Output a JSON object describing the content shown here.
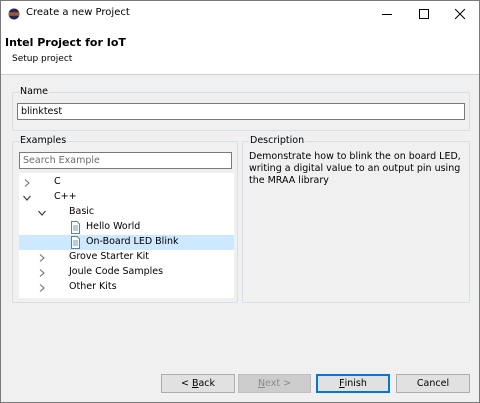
{
  "window": {
    "title": "Create a new Project",
    "controls": {
      "minimize": "minimize-icon",
      "maximize": "maximize-icon",
      "close": "close-icon"
    }
  },
  "header": {
    "title": "Intel Project for IoT",
    "subtitle": "Setup project"
  },
  "name_group": {
    "label": "Name",
    "value": "blinktest"
  },
  "examples_group": {
    "label": "Examples",
    "search_placeholder": "Search Example",
    "tree": [
      {
        "label": "C",
        "expanded": false,
        "level": 0,
        "type": "folder"
      },
      {
        "label": "C++",
        "expanded": true,
        "level": 0,
        "type": "folder"
      },
      {
        "label": "Basic",
        "expanded": true,
        "level": 1,
        "type": "folder"
      },
      {
        "label": "Hello World",
        "level": 2,
        "type": "file"
      },
      {
        "label": "On-Board LED Blink",
        "level": 2,
        "type": "file",
        "selected": true
      },
      {
        "label": "Grove Starter Kit",
        "expanded": false,
        "level": 1,
        "type": "folder"
      },
      {
        "label": "Joule Code Samples",
        "expanded": false,
        "level": 1,
        "type": "folder"
      },
      {
        "label": "Other Kits",
        "expanded": false,
        "level": 1,
        "type": "folder"
      }
    ]
  },
  "description_group": {
    "label": "Description",
    "text": "Demonstrate how to blink the on board LED, writing a digital value to an output pin using the MRAA library"
  },
  "buttons": {
    "back": {
      "prefix": "< ",
      "mnemonic": "B",
      "rest": "ack"
    },
    "next": {
      "mnemonic": "N",
      "rest": "ext >",
      "enabled": false
    },
    "finish": {
      "mnemonic": "F",
      "rest": "inish"
    },
    "cancel": "Cancel"
  },
  "colors": {
    "selection": "#cde8ff",
    "default_button_border": "#0078d7",
    "group_border": "#d5dfe5"
  }
}
